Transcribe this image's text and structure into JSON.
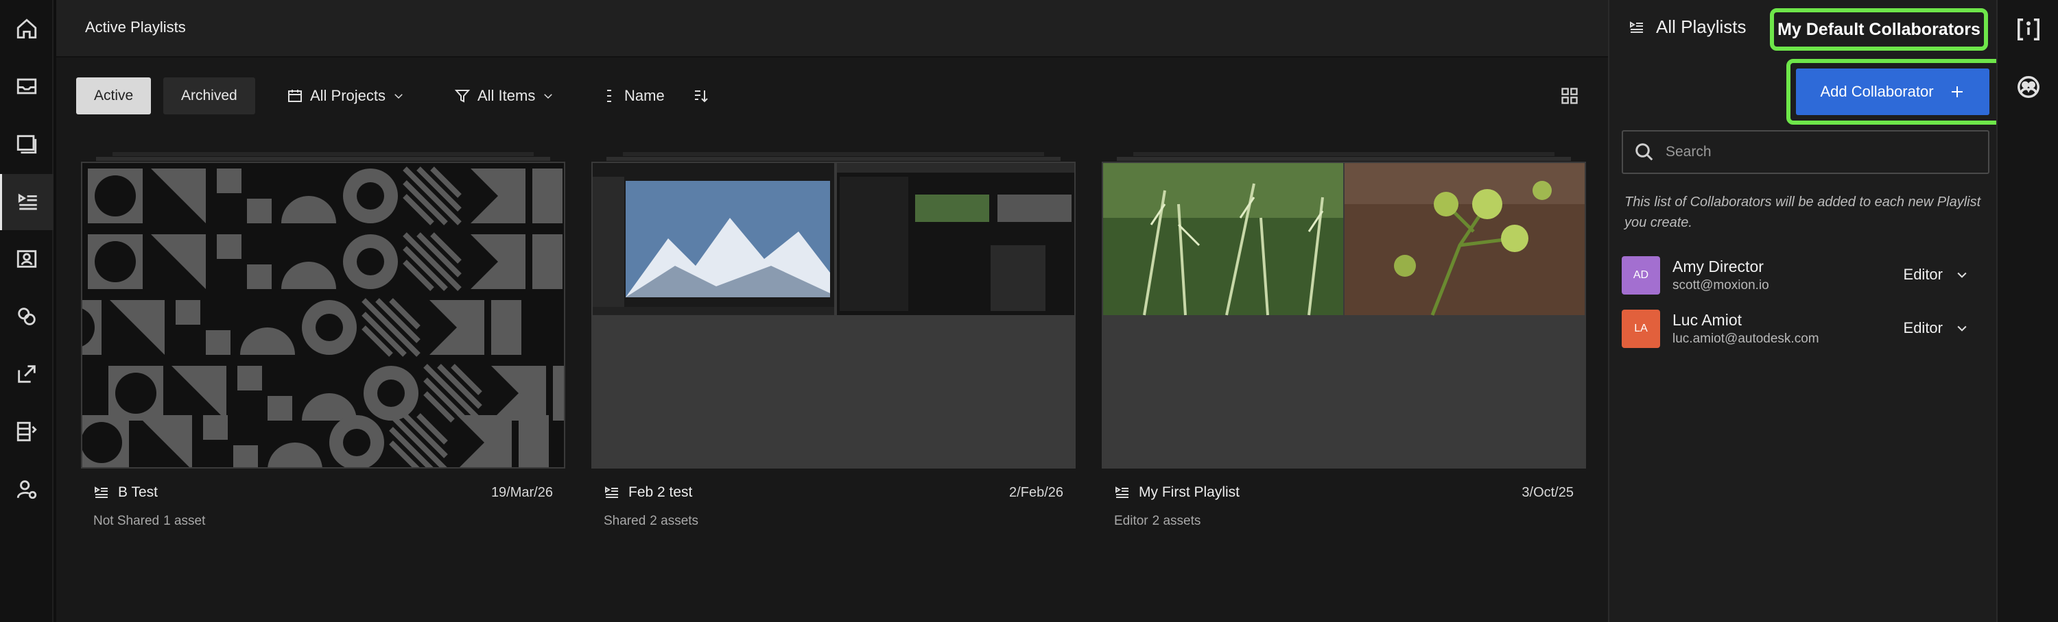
{
  "nav": {
    "items": [
      {
        "icon": "home-icon"
      },
      {
        "icon": "inbox-icon"
      },
      {
        "icon": "review-icon"
      },
      {
        "icon": "playlists-icon",
        "active": true
      },
      {
        "icon": "contacts-icon"
      },
      {
        "icon": "links-icon"
      },
      {
        "icon": "share-icon"
      },
      {
        "icon": "layout-icon"
      },
      {
        "icon": "user-settings-icon"
      }
    ]
  },
  "main": {
    "title": "Active Playlists",
    "filters": {
      "active_label": "Active",
      "archived_label": "Archived",
      "projects_label": "All Projects",
      "items_label": "All Items",
      "sort_label": "Name"
    },
    "cards": [
      {
        "title": "B Test",
        "date": "19/Mar/26",
        "status": "Not Shared",
        "assets": "1 asset"
      },
      {
        "title": "Feb 2 test",
        "date": "2/Feb/26",
        "status": "Shared",
        "assets": "2 assets"
      },
      {
        "title": "My First Playlist",
        "date": "3/Oct/25",
        "status": "Editor",
        "assets": "2 assets"
      }
    ]
  },
  "panel": {
    "tab_all": "All Playlists",
    "tab_default": "My Default Collaborators",
    "add_button": "Add Collaborator",
    "search_placeholder": "Search",
    "hint": "This list of Collaborators will be added to each new Playlist you create.",
    "collaborators": [
      {
        "initials": "AD",
        "name": "Amy Director",
        "email": "scott@moxion.io",
        "role": "Editor",
        "color": "#a36fd0"
      },
      {
        "initials": "LA",
        "name": "Luc Amiot",
        "email": "luc.amiot@autodesk.com",
        "role": "Editor",
        "color": "#e2603c"
      }
    ]
  },
  "colors": {
    "accent_blue": "#2e6ad8",
    "highlight_green": "#6ee64a"
  }
}
